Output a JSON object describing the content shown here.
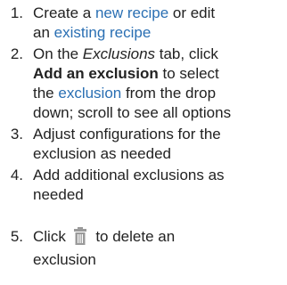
{
  "steps": [
    {
      "number": "1.",
      "line1_text": "Create a ",
      "link_new": "new recipe",
      "line1_or": " or edit",
      "line2_an": "an ",
      "link_existing": "existing recipe"
    },
    {
      "number": "2.",
      "on_the": "On the ",
      "tab_name": "Exclusions",
      "tab_click": " tab, click",
      "add_label": "Add an exclusion",
      "to_select": " to select",
      "the_prefix": "the ",
      "link_exclusion": "exclusion",
      "from_drop": " from the drop",
      "line4": "down; scroll to see all options"
    },
    {
      "number": "3.",
      "line1": "Adjust configurations for the",
      "line2": "exclusion as needed"
    },
    {
      "number": "4.",
      "line1": "Add additional exclusions as",
      "line2": "needed"
    },
    {
      "number": "5.",
      "click": "Click",
      "after_icon": "to delete an",
      "line2": "exclusion",
      "icon": "trash-icon"
    }
  ],
  "colors": {
    "text": "#222222",
    "link": "#2a6fb3",
    "icon": "#9a9a9a"
  }
}
